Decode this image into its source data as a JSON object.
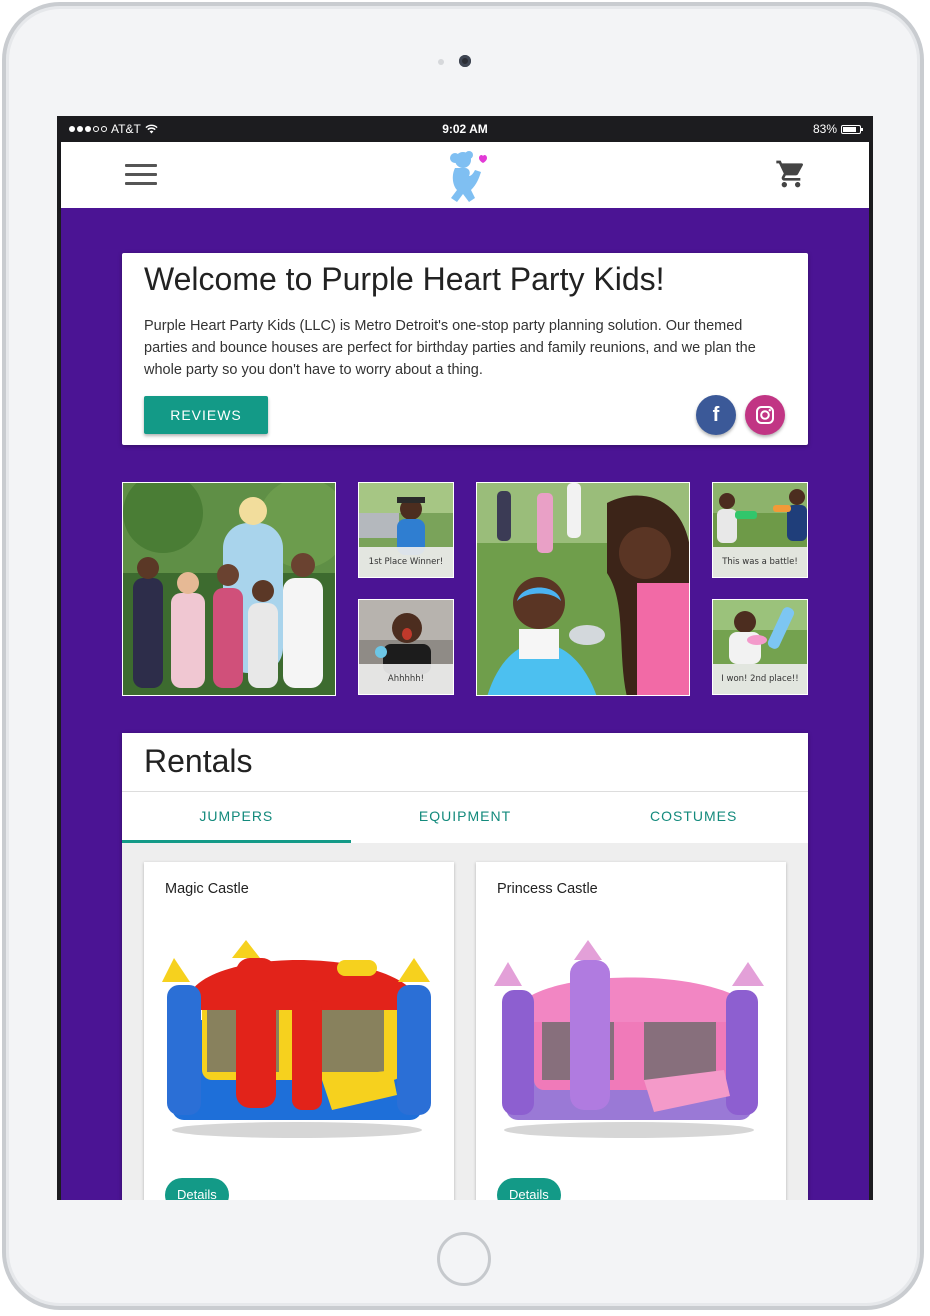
{
  "status_bar": {
    "carrier": "AT&T",
    "time": "9:02 AM",
    "battery": "83%",
    "battery_level": 0.83
  },
  "app_bar": {
    "menu_icon": "hamburger-menu-icon",
    "logo_icon": "teddy-bear-heart-logo",
    "cart_icon": "shopping-cart-icon",
    "colors": {
      "bar": "#ffffff",
      "logo": "#7fbff2",
      "heart": "#e23ad6"
    }
  },
  "welcome": {
    "title": "Welcome to Purple Heart Party Kids!",
    "description": "Purple Heart Party Kids (LLC) is Metro Detroit's one-stop party planning solution. Our themed parties and bounce houses are perfect for birthday parties and family reunions, and we plan the whole party so you don't have to worry about a thing.",
    "reviews_button": "REVIEWS",
    "facebook_icon": "facebook-icon",
    "instagram_icon": "instagram-icon",
    "facebook_glyph": "f"
  },
  "gallery": {
    "captions": [
      "1st Place Winner!",
      "Ahhhhh!",
      "This was a battle!",
      "I won! 2nd place!!"
    ]
  },
  "rentals": {
    "title": "Rentals",
    "tabs": [
      "JUMPERS",
      "EQUIPMENT",
      "COSTUMES"
    ],
    "active_tab": "JUMPERS",
    "items": [
      {
        "name": "Magic Castle",
        "button": "Details"
      },
      {
        "name": "Princess Castle",
        "button": "Details"
      }
    ]
  },
  "colors": {
    "page_background": "#4b1494",
    "accent": "#139a87",
    "tab_text": "#138a7c"
  }
}
